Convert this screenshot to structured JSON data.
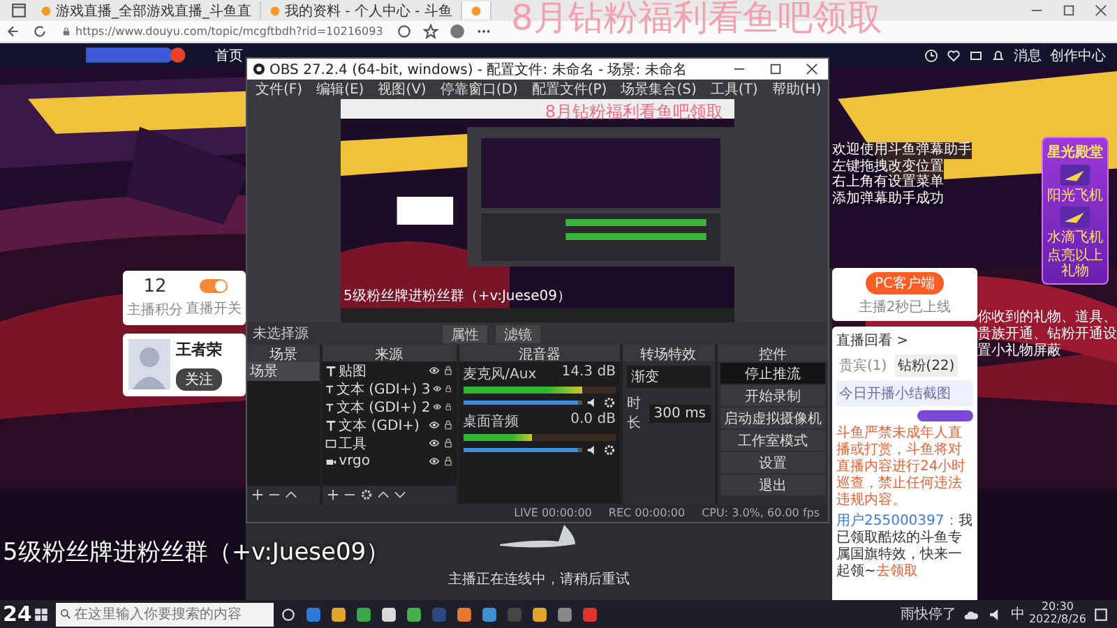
{
  "browser": {
    "tabs": [
      {
        "title": "游戏直播_全部游戏直播_斗鱼直",
        "selected": false
      },
      {
        "title": "我的资料 - 个人中心 - 斗鱼",
        "selected": false
      },
      {
        "selected": true
      }
    ],
    "url": "https://www.douyu.com/topic/mcgftbdh?rid=10216093"
  },
  "site": {
    "nav": "首页",
    "header_links": [
      "消息",
      "创作中心"
    ],
    "score": "12",
    "score_label": "主播积分",
    "live_switch_label": "直播开关",
    "live_on": true,
    "streamer_name": "王者荣",
    "follow": "关注",
    "client_button": "PC客户端",
    "client_note": "主播2秒已上线",
    "replay": "直播回看 >",
    "chat_tabs": [
      {
        "label": "贵宾(1)",
        "selected": false
      },
      {
        "label": "钻粉(22)",
        "selected": true
      }
    ],
    "chat_notice": "今日开播小结截图",
    "rules_text": "斗鱼严禁未成年人直播或打赏，斗鱼将对直播内容进行24小时巡查，禁止任何违法违规内容。",
    "chat_message": {
      "user": "用户255000397：",
      "text": "我已领取酷炫的斗鱼专属国旗特效，快来一起领~",
      "link": "去领取"
    },
    "helper_lines": [
      "欢迎使用斗鱼弹幕助手",
      "左键拖拽改变位置",
      "右上角有设置菜单",
      "添加弹幕助手成功"
    ],
    "gift_panel": {
      "title": "星光殿堂",
      "gifts": [
        "阳光飞机",
        "水滴飞机"
      ],
      "footer": "点亮以上礼物"
    },
    "chat_hint": "你收到的礼物、道具、贵族开通、钻粉开通设置小礼物屏蔽",
    "player_status": "主播正在连线中，请稍后重试"
  },
  "obs": {
    "title": "OBS 27.2.4 (64-bit, windows) - 配置文件: 未命名 - 场景: 未命名",
    "menu": [
      "文件(F)",
      "编辑(E)",
      "视图(V)",
      "停靠窗口(D)",
      "配置文件(P)",
      "场景集合(S)",
      "工具(T)",
      "帮助(H)"
    ],
    "preview_overlays": [
      "8月钻粉福利看鱼吧领取",
      "5级粉丝牌进粉丝群（+v:Juese09）"
    ],
    "no_source": "未选择源",
    "properties": "属性",
    "filters": "滤镜",
    "docks": {
      "scenes": "场景",
      "sources": "来源",
      "mixer": "混音器",
      "transitions": "转场特效",
      "controls": "控件"
    },
    "scenes": [
      {
        "name": "场景",
        "selected": true
      }
    ],
    "sources": [
      {
        "name": "贴图",
        "kind": "text",
        "visible": true
      },
      {
        "name": "文本 (GDI+) 3",
        "kind": "text",
        "visible": true
      },
      {
        "name": "文本 (GDI+) 2",
        "kind": "text",
        "visible": true
      },
      {
        "name": "文本 (GDI+)",
        "kind": "text",
        "visible": true
      },
      {
        "name": "工具",
        "kind": "display",
        "visible": true
      },
      {
        "name": "vrgo",
        "kind": "camera",
        "visible": true
      }
    ],
    "mixer": [
      {
        "name": "麦克风/Aux",
        "reading": "14.3 dB",
        "level": 0.78,
        "volume": {
          "level": 0.96
        }
      },
      {
        "name": "桌面音频",
        "reading": "0.0 dB",
        "level": 0.45,
        "volume": {
          "level": 0.96
        }
      }
    ],
    "transition": {
      "type": "渐变",
      "duration_label": "时长",
      "duration": "300 ms"
    },
    "controls": [
      {
        "label": "停止推流",
        "selected": true
      },
      {
        "label": "开始录制",
        "selected": false
      },
      {
        "label": "启动虚拟摄像机",
        "selected": false
      },
      {
        "label": "工作室模式",
        "selected": false
      },
      {
        "label": "设置",
        "selected": false
      },
      {
        "label": "退出",
        "selected": false
      }
    ],
    "status": [
      "LIVE 00:00:00",
      "REC 00:00:00",
      "CPU: 3.0%, 60.00 fps"
    ]
  },
  "overlays": [
    "8月钻粉福利看鱼吧领取",
    "5级粉丝牌进粉丝群（+v:Juese09）",
    "24"
  ],
  "taskbar": {
    "search_placeholder": "在这里输入你要搜索的内容",
    "weather": "雨快停了",
    "ime": "中",
    "time": "20:30",
    "date": "2022/8/26"
  }
}
